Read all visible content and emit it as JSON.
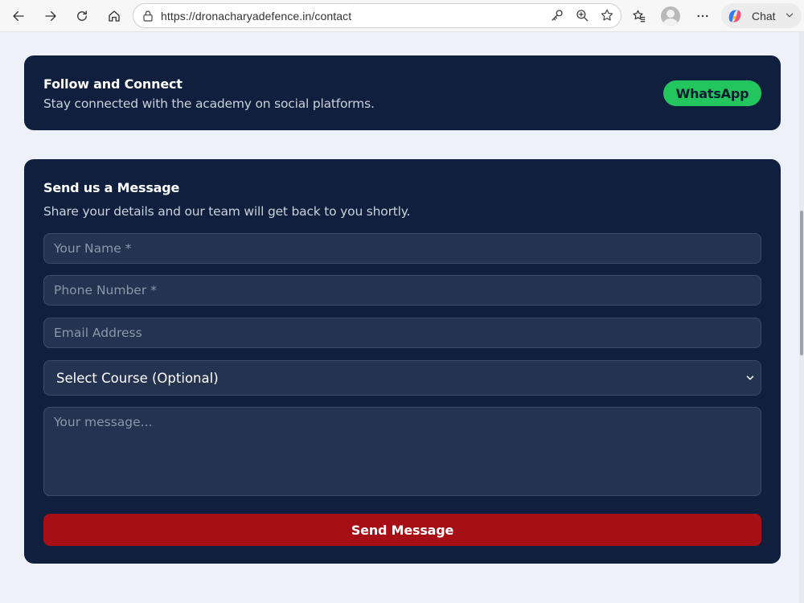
{
  "browser": {
    "url": "https://dronacharyadefence.in/contact",
    "chat_label": "Chat"
  },
  "follow": {
    "title": "Follow and Connect",
    "subtitle": "Stay connected with the academy on social platforms.",
    "whatsapp_label": "WhatsApp"
  },
  "message_form": {
    "title": "Send us a Message",
    "subtitle": "Share your details and our team will get back to you shortly.",
    "name_placeholder": "Your Name *",
    "phone_placeholder": "Phone Number *",
    "email_placeholder": "Email Address",
    "course_selected": "Select Course (Optional)",
    "message_placeholder": "Your message...",
    "send_label": "Send Message"
  },
  "colors": {
    "card_bg": "#0f1f3d",
    "field_bg": "#243350",
    "whatsapp": "#22c55e",
    "send": "#a50f15",
    "page_bg": "#eef2f8"
  },
  "icons": [
    "back-icon",
    "forward-icon",
    "refresh-icon",
    "home-icon",
    "lock-icon",
    "key-icon",
    "zoom-icon",
    "star-icon",
    "favorites-icon",
    "profile-icon",
    "more-icon",
    "copilot-icon",
    "chevron-down-icon"
  ]
}
